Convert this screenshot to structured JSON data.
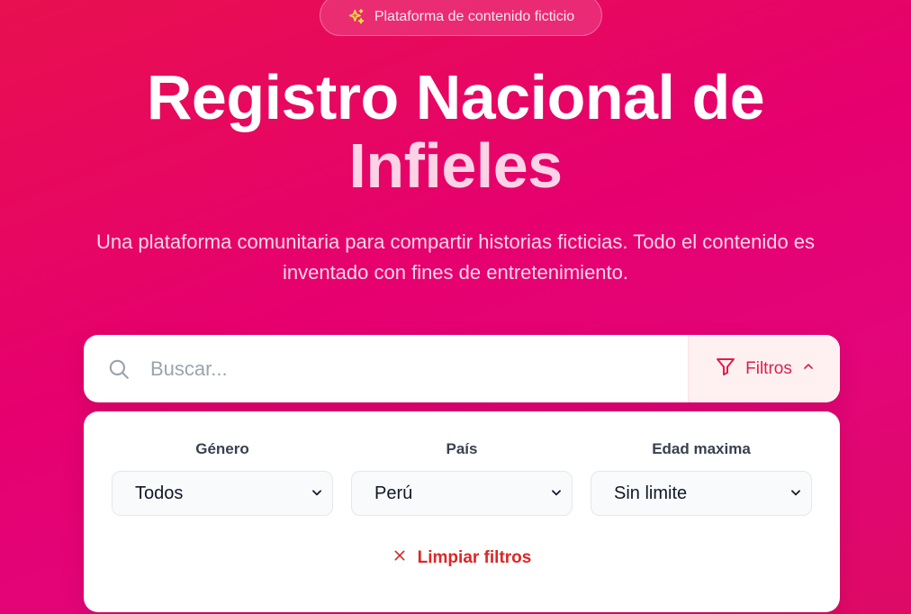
{
  "badge": {
    "icon": "sparkles-icon",
    "label": "Plataforma de contenido ficticio"
  },
  "hero": {
    "title_line1": "Registro Nacional de",
    "title_line2": "Infieles",
    "subtitle": "Una plataforma comunitaria para compartir historias ficticias. Todo el contenido es inventado con fines de entretenimiento."
  },
  "search": {
    "placeholder": "Buscar...",
    "value": "",
    "icon": "search-icon",
    "filters_label": "Filtros",
    "filters_icon": "filter-icon",
    "filters_toggle_icon": "chevron-up-icon"
  },
  "filters": {
    "genero": {
      "label": "Género",
      "selected": "Todos"
    },
    "pais": {
      "label": "País",
      "selected": "Perú"
    },
    "edad": {
      "label": "Edad maxima",
      "selected": "Sin limite"
    },
    "clear_label": "Limpiar filtros",
    "clear_icon": "close-icon"
  },
  "colors": {
    "background": "#e6006f",
    "accent": "#e11d48",
    "clear": "#dc2626",
    "title_highlight": "#fcd3e6"
  }
}
